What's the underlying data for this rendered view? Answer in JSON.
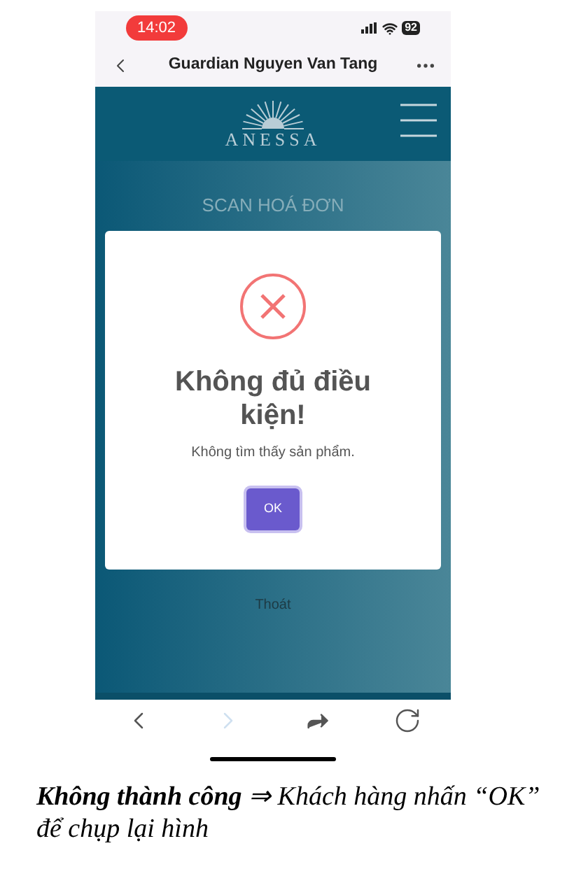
{
  "status_bar": {
    "time": "14:02",
    "battery": "92"
  },
  "browser": {
    "title": "Guardian Nguyen Van Tang"
  },
  "page": {
    "brand": "ANESSA",
    "heading": "SCAN HOÁ ĐƠN",
    "exit_link": "Thoát"
  },
  "dialog": {
    "title": "Không đủ điều kiện!",
    "message": "Không tìm thấy sản phẩm.",
    "button": "OK"
  },
  "toolbar": [
    {
      "kind": "back",
      "disabled": false
    },
    {
      "kind": "forward",
      "disabled": true
    },
    {
      "kind": "share",
      "disabled": false
    },
    {
      "kind": "reload",
      "disabled": false
    }
  ],
  "caption": "**Không thành công** ⇒ Khách hàng nhấn “OK” để chụp lại hình"
}
